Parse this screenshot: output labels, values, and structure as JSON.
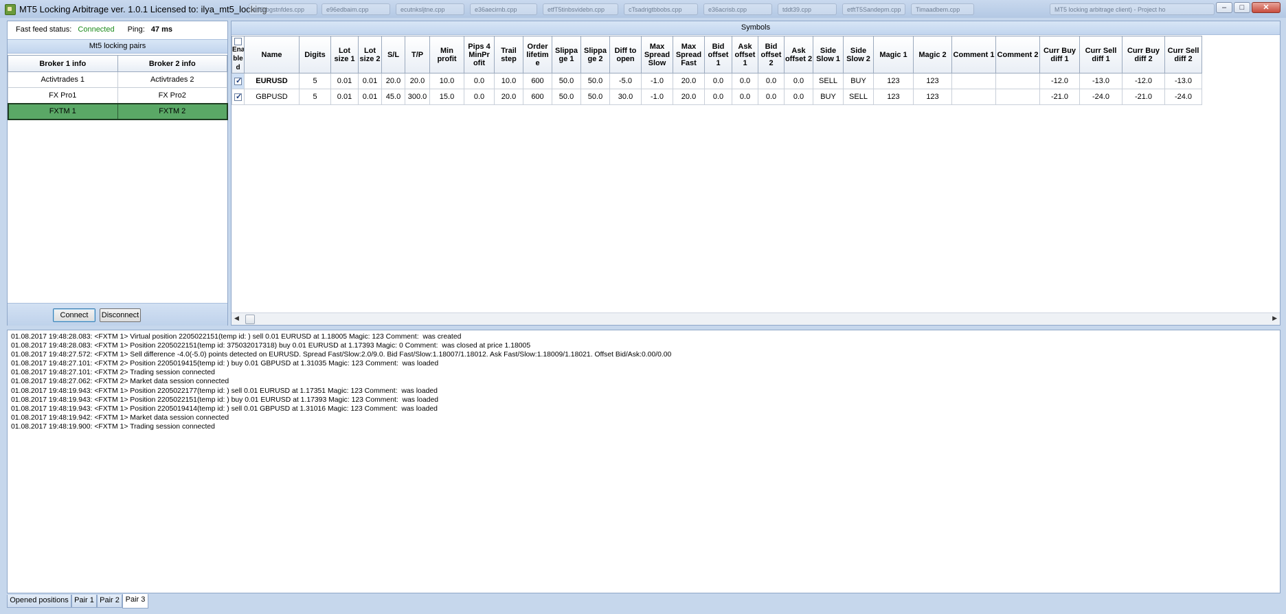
{
  "window": {
    "title": "MT5 Locking Arbitrage ver. 1.0.1 Licensed to: ilya_mt5_locking",
    "background_tabs": [
      "e96rbgstnfdes.cpp",
      "e96edbaim.cpp",
      "ecutnksljtne.cpp",
      "e36aecirnb.cpp",
      "etfT5tinbsvidebn.cpp",
      "cTsadrigtbbobs.cpp",
      "e36acrisb.cpp",
      "tddt39.cpp",
      "etftT5Sandepm.cpp",
      "Timaadbem.cpp",
      "MT5 locking arbitrage client) - Project ho"
    ]
  },
  "status": {
    "feed_label": "Fast feed status:",
    "feed_value": "Connected",
    "ping_label": "Ping:",
    "ping_value": "47 ms"
  },
  "pairs": {
    "title": "Mt5 locking pairs",
    "columns": [
      "Broker 1 info",
      "Broker 2 info"
    ],
    "rows": [
      [
        "Activtrades 1",
        "Activtrades 2"
      ],
      [
        "FX Pro1",
        "FX Pro2"
      ],
      [
        "FXTM 1",
        "FXTM 2"
      ]
    ],
    "selected_index": 2,
    "connect_label": "Connect",
    "disconnect_label": "Disconnect"
  },
  "symbols": {
    "title": "Symbols",
    "columns": [
      "Ena ble d",
      "Name",
      "Digits",
      "Lot size 1",
      "Lot size 2",
      "S/L",
      "T/P",
      "Min profit",
      "Pips 4 MinPr ofit",
      "Trail step",
      "Order lifetim e",
      "Slippa ge 1",
      "Slippa ge 2",
      "Diff to open",
      "Max Spread Slow",
      "Max Spread Fast",
      "Bid offset 1",
      "Ask offset 1",
      "Bid offset 2",
      "Ask offset 2",
      "Side Slow 1",
      "Side Slow 2",
      "Magic 1",
      "Magic 2",
      "Comment 1",
      "Comment 2",
      "Curr Buy diff 1",
      "Curr Sell diff 1",
      "Curr Buy diff 2",
      "Curr Sell diff 2"
    ],
    "rows": [
      {
        "enabled": true,
        "cells": [
          "EURUSD",
          "5",
          "0.01",
          "0.01",
          "20.0",
          "20.0",
          "10.0",
          "0.0",
          "10.0",
          "600",
          "50.0",
          "50.0",
          "-5.0",
          "-1.0",
          "20.0",
          "0.0",
          "0.0",
          "0.0",
          "0.0",
          "SELL",
          "BUY",
          "123",
          "123",
          "",
          "",
          "-12.0",
          "-13.0",
          "-12.0",
          "-13.0"
        ]
      },
      {
        "enabled": true,
        "cells": [
          "GBPUSD",
          "5",
          "0.01",
          "0.01",
          "45.0",
          "300.0",
          "15.0",
          "0.0",
          "20.0",
          "600",
          "50.0",
          "50.0",
          "30.0",
          "-1.0",
          "20.0",
          "0.0",
          "0.0",
          "0.0",
          "0.0",
          "BUY",
          "SELL",
          "123",
          "123",
          "",
          "",
          "-21.0",
          "-24.0",
          "-21.0",
          "-24.0"
        ]
      }
    ]
  },
  "log": [
    "01.08.2017 19:48:28.083: <FXTM 1> Virtual position 2205022151(temp id: ) sell 0.01 EURUSD at 1.18005 Magic: 123 Comment:  was created",
    "01.08.2017 19:48:28.083: <FXTM 1> Position 2205022151(temp id: 375032017318) buy 0.01 EURUSD at 1.17393 Magic: 0 Comment:  was closed at price 1.18005",
    "01.08.2017 19:48:27.572: <FXTM 1> Sell difference -4.0(-5.0) points detected on EURUSD. Spread Fast/Slow:2.0/9.0. Bid Fast/Slow:1.18007/1.18012. Ask Fast/Slow:1.18009/1.18021. Offset Bid/Ask:0.00/0.00",
    "01.08.2017 19:48:27.101: <FXTM 2> Position 2205019415(temp id: ) buy 0.01 GBPUSD at 1.31035 Magic: 123 Comment:  was loaded",
    "01.08.2017 19:48:27.101: <FXTM 2> Trading session connected",
    "01.08.2017 19:48:27.062: <FXTM 2> Market data session connected",
    "01.08.2017 19:48:19.943: <FXTM 1> Position 2205022177(temp id: ) sell 0.01 EURUSD at 1.17351 Magic: 123 Comment:  was loaded",
    "01.08.2017 19:48:19.943: <FXTM 1> Position 2205022151(temp id: ) buy 0.01 EURUSD at 1.17393 Magic: 123 Comment:  was loaded",
    "01.08.2017 19:48:19.943: <FXTM 1> Position 2205019414(temp id: ) sell 0.01 GBPUSD at 1.31016 Magic: 123 Comment:  was loaded",
    "01.08.2017 19:48:19.942: <FXTM 1> Market data session connected",
    "01.08.2017 19:48:19.900: <FXTM 1> Trading session connected"
  ],
  "tabs": {
    "items": [
      "Opened positions",
      "Pair 1",
      "Pair 2",
      "Pair 3"
    ],
    "active_index": 3
  },
  "colors": {
    "accent": "#c6d7ec",
    "selected_row": "#5aa866",
    "connected": "#1a8a1a"
  }
}
